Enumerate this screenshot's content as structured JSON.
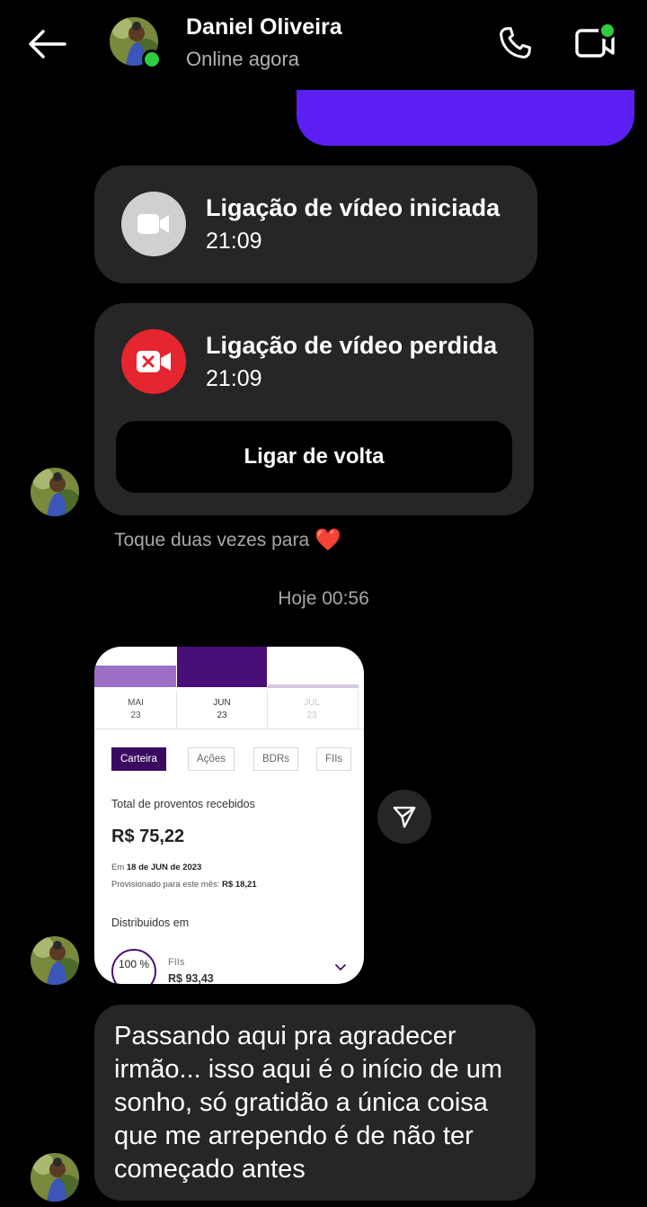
{
  "header": {
    "contact_name": "Daniel Oliveira",
    "status": "Online agora",
    "icons": [
      "back-arrow-icon",
      "phone-icon",
      "video-camera-icon"
    ],
    "online_color": "#2ecc40"
  },
  "calls": [
    {
      "title": "Ligação de vídeo iniciada",
      "time": "21:09",
      "icon": "video-camera-icon"
    },
    {
      "title": "Ligação de vídeo perdida",
      "time": "21:09",
      "icon": "missed-video-icon",
      "action_label": "Ligar de volta"
    }
  ],
  "hint": {
    "text": "Toque duas vezes para",
    "emoji": "❤️"
  },
  "day_separator": "Hoje 00:56",
  "shared_screenshot": {
    "months": [
      {
        "name": "MAI",
        "year": "23"
      },
      {
        "name": "JUN",
        "year": "23"
      },
      {
        "name": "JUL",
        "year": "23"
      }
    ],
    "tabs": [
      "Carteira",
      "Ações",
      "BDRs",
      "FIIs"
    ],
    "total_label": "Total de proventos recebidos",
    "total_amount": "R$ 75,22",
    "date_prefix": "Em",
    "date_value": "18 de JUN de 2023",
    "provisioned_label": "Provisionado para este mês:",
    "provisioned_value": "R$ 18,21",
    "distributed_label": "Distribuidos em",
    "percent": "100 %",
    "fund_type": "FIIs",
    "fund_value": "R$ 93,43"
  },
  "message": {
    "text": "Passando aqui pra agradecer irmão... isso aqui é o início de um sonho, só gratidão a única coisa que me arrependo é de não ter começado antes"
  },
  "colors": {
    "sent_bubble": "#5b1ff3",
    "received_bubble": "#262626",
    "missed_red": "#e5252f",
    "app_purple": "#4a0e78"
  }
}
